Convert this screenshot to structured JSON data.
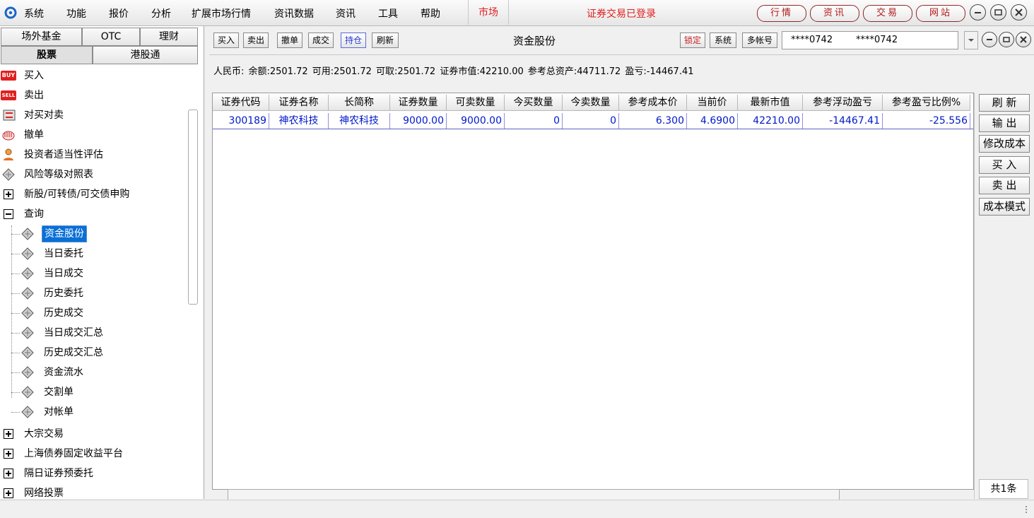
{
  "menu": {
    "items": [
      "系统",
      "功能",
      "报价",
      "分析",
      "扩展市场行情",
      "资讯数据",
      "资讯",
      "工具",
      "帮助"
    ],
    "market_tab": "市场",
    "login_status": "证券交易已登录",
    "top_buttons": [
      "行情",
      "资讯",
      "交易",
      "网站"
    ]
  },
  "left": {
    "tabs_row1": [
      "场外基金",
      "OTC",
      "理财"
    ],
    "tabs_row2": [
      "股票",
      "港股通"
    ],
    "nav": {
      "buy": "买入",
      "sell": "卖出",
      "pair": "对买对卖",
      "cancel": "撤单",
      "suitability": "投资者适当性评估",
      "risk": "风险等级对照表",
      "ipo": "新股/可转债/可交债申购",
      "query": "查询",
      "children": [
        "资金股份",
        "当日委托",
        "当日成交",
        "历史委托",
        "历史成交",
        "当日成交汇总",
        "历史成交汇总",
        "资金流水",
        "交割单",
        "对帐单"
      ],
      "block": "大宗交易",
      "bond": "上海债券固定收益平台",
      "pre": "隔日证券预委托",
      "net": "网络投票"
    },
    "icons": {
      "buy": "BUY",
      "sell": "SELL"
    }
  },
  "toolbar": {
    "buttons": [
      "买入",
      "卖出",
      "撤单",
      "成交",
      "持仓",
      "刷新"
    ],
    "title": "资金股份",
    "lock": "锁定",
    "system": "系统",
    "multi": "多帐号",
    "account1": "****0742",
    "account2": "****0742"
  },
  "summary": "人民币: 余额:2501.72  可用:2501.72  可取:2501.72  证券市值:42210.00  参考总资产:44711.72  盈亏:-14467.41",
  "table": {
    "headers": [
      "证券代码",
      "证券名称",
      "长简称",
      "证券数量",
      "可卖数量",
      "今买数量",
      "今卖数量",
      "参考成本价",
      "当前价",
      "最新市值",
      "参考浮动盈亏",
      "参考盈亏比例%"
    ],
    "rows": [
      [
        "300189",
        "神农科技",
        "神农科技",
        "9000.00",
        "9000.00",
        "0",
        "0",
        "6.300",
        "4.6900",
        "42210.00",
        "-14467.41",
        "-25.556"
      ]
    ]
  },
  "side_buttons": [
    "刷 新",
    "输 出",
    "修改成本",
    "买 入",
    "卖 出",
    "成本模式"
  ],
  "record_count": "共1条",
  "colors": {
    "accent": "#e02020",
    "link": "#0018c8",
    "selection": "#0a6fd6"
  }
}
